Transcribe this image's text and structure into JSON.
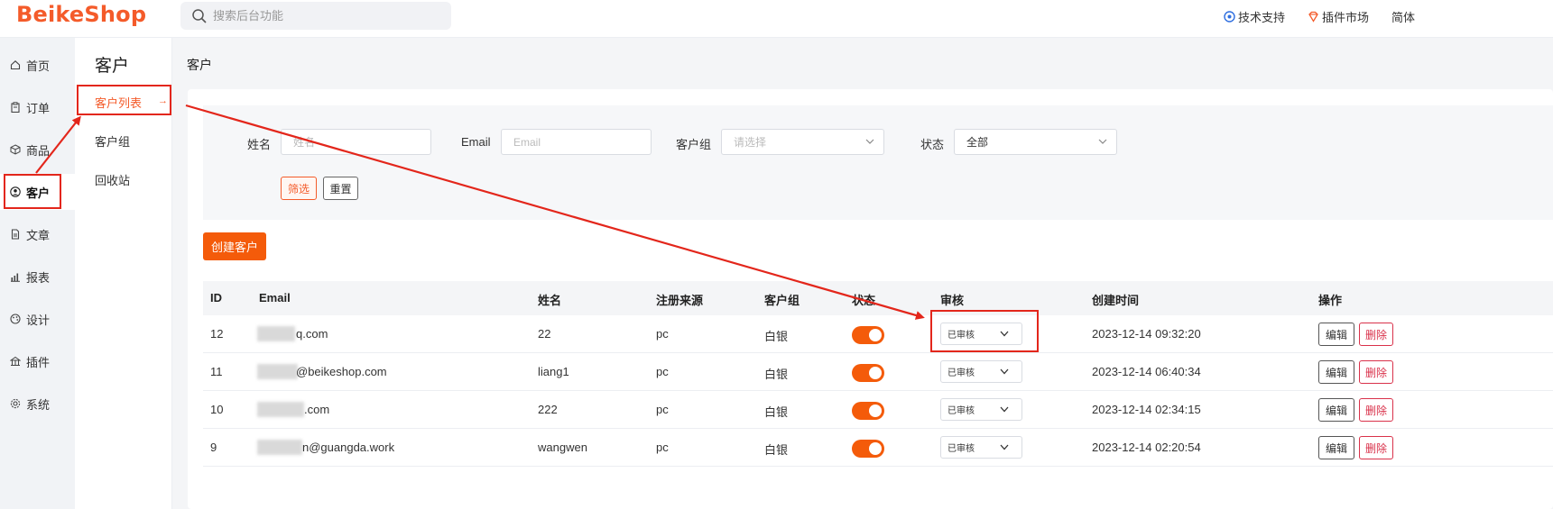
{
  "header": {
    "logo": "BeikeShop",
    "search_placeholder": "搜索后台功能",
    "links": [
      "技术支持",
      "插件市场",
      "简体"
    ]
  },
  "main_nav": {
    "items": [
      "首页",
      "订单",
      "商品",
      "客户",
      "文章",
      "报表",
      "设计",
      "插件",
      "系统"
    ],
    "active": "客户"
  },
  "sub_nav": {
    "title": "客户",
    "items": [
      "客户列表",
      "客户组",
      "回收站"
    ],
    "active": "客户列表",
    "arrow": "→"
  },
  "page": {
    "title": "客户"
  },
  "filters": {
    "name_label": "姓名",
    "name_placeholder": "姓名",
    "email_label": "Email",
    "email_placeholder": "Email",
    "group_label": "客户组",
    "group_placeholder": "请选择",
    "status_label": "状态",
    "status_value": "全部",
    "filter_button": "筛选",
    "reset_button": "重置"
  },
  "create_button": "创建客户",
  "table": {
    "headers": [
      "ID",
      "Email",
      "姓名",
      "注册来源",
      "客户组",
      "状态",
      "审核",
      "创建时间",
      "操作"
    ],
    "rows": [
      {
        "id": "12",
        "email": "q.com",
        "name": "22",
        "source": "pc",
        "group": "白银",
        "audit": "已审核",
        "created": "2023-12-14 09:32:20",
        "status_on": true
      },
      {
        "id": "11",
        "email": "@beikeshop.com",
        "name": "liang1",
        "source": "pc",
        "group": "白银",
        "audit": "已审核",
        "created": "2023-12-14 06:40:34",
        "status_on": true
      },
      {
        "id": "10",
        "email": ".com",
        "name": "222",
        "source": "pc",
        "group": "白银",
        "audit": "已审核",
        "created": "2023-12-14 02:34:15",
        "status_on": true
      },
      {
        "id": "9",
        "email": "n@guangda.work",
        "name": "wangwen",
        "source": "pc",
        "group": "白银",
        "audit": "已审核",
        "created": "2023-12-14 02:20:54",
        "status_on": true
      }
    ],
    "edit_label": "编辑",
    "delete_label": "删除"
  },
  "colors": {
    "accent": "#f45b0a",
    "annotation": "#e3261b",
    "danger": "#d9314a"
  }
}
